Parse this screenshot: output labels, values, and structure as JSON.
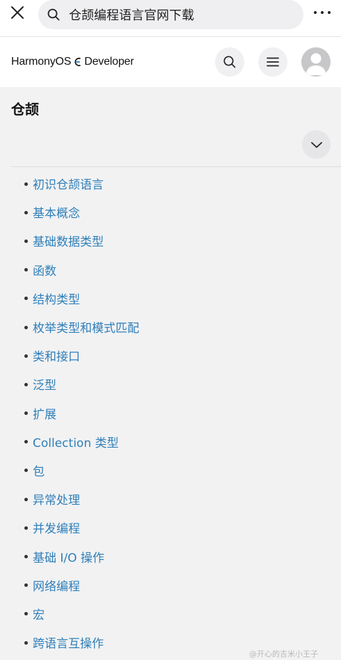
{
  "browser": {
    "search_query": "仓颉编程语言官网下载"
  },
  "site": {
    "brand": "HarmonyOS",
    "brand_suffix": "Developer"
  },
  "section": {
    "title": "仓颉"
  },
  "nav": {
    "items": [
      {
        "label": "初识仓颉语言"
      },
      {
        "label": "基本概念"
      },
      {
        "label": "基础数据类型"
      },
      {
        "label": "函数"
      },
      {
        "label": "结构类型"
      },
      {
        "label": "枚举类型和模式匹配"
      },
      {
        "label": "类和接口"
      },
      {
        "label": "泛型"
      },
      {
        "label": "扩展"
      },
      {
        "label": "Collection 类型"
      },
      {
        "label": "包"
      },
      {
        "label": "异常处理"
      },
      {
        "label": "并发编程"
      },
      {
        "label": "基础 I/O 操作"
      },
      {
        "label": "网络编程"
      },
      {
        "label": "宏"
      },
      {
        "label": "跨语言互操作"
      }
    ]
  },
  "watermark": "@开心的吉米小王子",
  "icons": {
    "close": "close-icon",
    "search": "search-icon",
    "more": "more-dots-icon",
    "menu": "hamburger-menu-icon",
    "avatar": "user-avatar-icon",
    "collapse": "chevron-down-icon"
  },
  "colors": {
    "link": "#2f7fb8",
    "background": "#f2f2f3"
  }
}
